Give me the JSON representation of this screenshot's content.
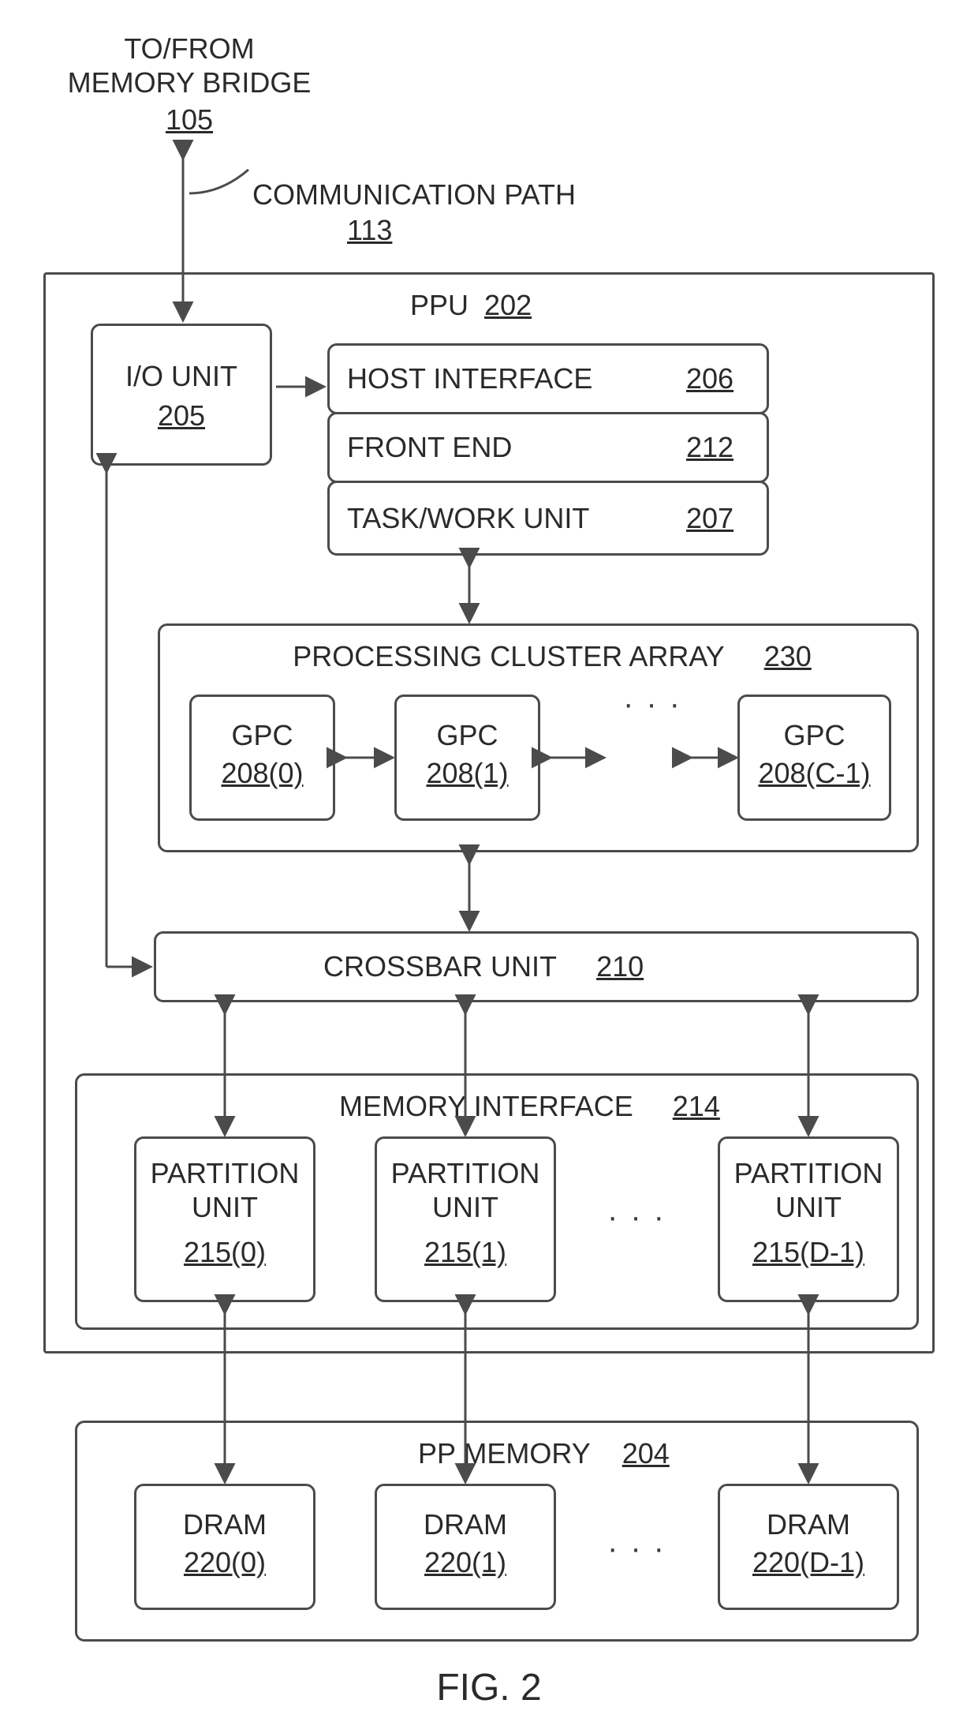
{
  "top": {
    "tofrom": "TO/FROM\nMEMORY BRIDGE",
    "tofrom_num": "105",
    "comm_path": "COMMUNICATION PATH",
    "comm_path_num": "113"
  },
  "ppu": {
    "title": "PPU",
    "num": "202",
    "io_unit": "I/O UNIT",
    "io_unit_num": "205",
    "host_if": "HOST INTERFACE",
    "host_if_num": "206",
    "front_end": "FRONT END",
    "front_end_num": "212",
    "task_work": "TASK/WORK UNIT",
    "task_work_num": "207",
    "proc_array": "PROCESSING CLUSTER ARRAY",
    "proc_array_num": "230",
    "gpc": "GPC",
    "gpc0_num": "208(0)",
    "gpc1_num": "208(1)",
    "gpcc_num": "208(C-1)",
    "crossbar": "CROSSBAR UNIT",
    "crossbar_num": "210",
    "mem_if": "MEMORY INTERFACE",
    "mem_if_num": "214",
    "part_unit": "PARTITION\nUNIT",
    "part0_num": "215(0)",
    "part1_num": "215(1)",
    "partd_num": "215(D-1)"
  },
  "ppmem": {
    "title": "PP MEMORY",
    "num": "204",
    "dram": "DRAM",
    "dram0_num": "220(0)",
    "dram1_num": "220(1)",
    "dramd_num": "220(D-1)"
  },
  "figure": "FIG. 2"
}
